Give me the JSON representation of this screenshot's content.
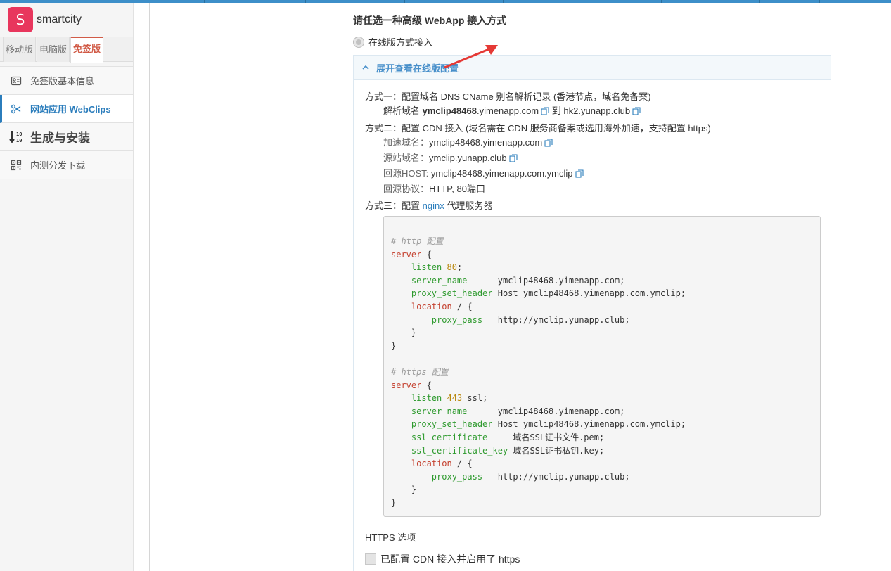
{
  "app": {
    "brand_letter": "S",
    "brand_name": "smartcity",
    "brand_color": "#e8365d",
    "accent_color": "#2b7dbc"
  },
  "sidebar": {
    "version_tabs": [
      {
        "label": "移动版",
        "active": false
      },
      {
        "label": "电脑版",
        "active": false
      },
      {
        "label": "免签版",
        "active": true
      }
    ],
    "items": [
      {
        "label": "免签版基本信息",
        "icon": "info-card-icon",
        "active": false
      },
      {
        "label": "网站应用 WebClips",
        "icon": "scissors-icon",
        "active": true
      },
      {
        "label": "生成与安装",
        "icon": "sort-numeric-icon",
        "active": false
      },
      {
        "label": "内测分发下载",
        "icon": "qrcode-icon",
        "active": false
      }
    ]
  },
  "main": {
    "section_title": "请任选一种高级 WebApp 接入方式",
    "radio_online_label": "在线版方式接入",
    "panel_header": "展开查看在线版配置",
    "method1": {
      "title": "方式一：配置域名 DNS CName 别名解析记录 (香港节点，域名免备案)",
      "prefix": "解析域名",
      "domain": "ymclip48468",
      "domain_suffix": ".yimenapp.com",
      "to": "到",
      "target": "hk2.yunapp.club"
    },
    "method2": {
      "title": "方式二：配置 CDN 接入 (域名需在 CDN 服务商备案或选用海外加速，支持配置 https)",
      "accel_label": "加速域名：",
      "accel_value": "ymclip48468.yimenapp.com",
      "origin_label": "源站域名：",
      "origin_value": "ymclip.yunapp.club",
      "host_label": "回源HOST:",
      "host_value": "ymclip48468.yimenapp.com.ymclip",
      "proto_label": "回源协议：",
      "proto_value": "HTTP, 80端口"
    },
    "method3": {
      "prefix": "方式三：配置",
      "link": "nginx",
      "suffix": "代理服务器"
    },
    "code": {
      "http_comment": "# http 配置",
      "https_comment": "# https 配置",
      "server_kw": "server",
      "listen_kw": "listen",
      "http_port": "80",
      "https_port": "443",
      "ssl_word": "ssl",
      "server_name_kw": "server_name",
      "server_name_val": "ymclip48468.yimenapp.com",
      "proxy_set_header_kw": "proxy_set_header",
      "proxy_set_header_val": "Host ymclip48468.yimenapp.com.ymclip",
      "location_kw": "location",
      "proxy_pass_kw": "proxy_pass",
      "proxy_pass_val": "http://ymclip.yunapp.club",
      "ssl_certificate_kw": "ssl_certificate",
      "ssl_certificate_val": "域名SSL证书文件.pem",
      "ssl_certificate_key_kw": "ssl_certificate_key",
      "ssl_certificate_key_val": "域名SSL证书私钥.key"
    },
    "https_options_title": "HTTPS 选项",
    "cdn_https_checkbox_label": "已配置 CDN 接入并启用了 https",
    "cdn_https_checked": false
  }
}
